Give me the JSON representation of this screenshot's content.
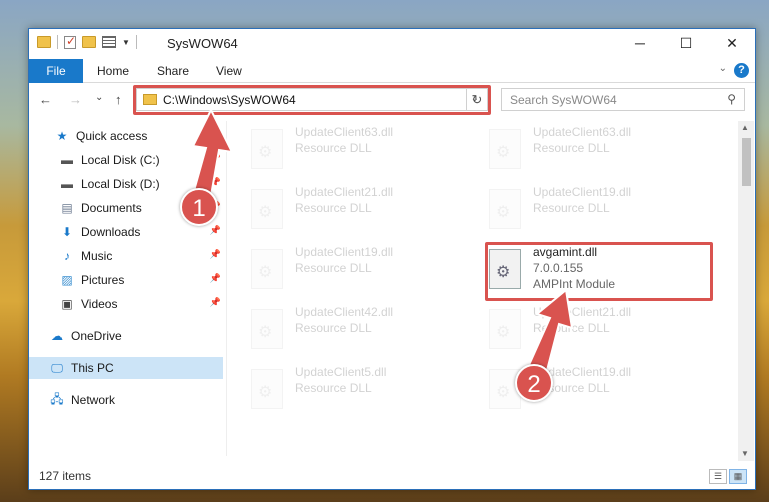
{
  "window": {
    "title": "SysWOW64",
    "controls": {
      "minimize": "─",
      "maximize": "☐",
      "close": "✕"
    }
  },
  "ribbon": {
    "file_label": "File",
    "tabs": [
      "Home",
      "Share",
      "View"
    ],
    "help_label": "?"
  },
  "navigation": {
    "back": "←",
    "forward": "→",
    "recent": "⌄",
    "up": "↑",
    "address": "C:\\Windows\\SysWOW64",
    "refresh": "↻",
    "search_placeholder": "Search SysWOW64"
  },
  "sidebar": {
    "items": [
      {
        "label": "Quick access",
        "icon": "star-icon"
      },
      {
        "label": "Local Disk (C:)",
        "icon": "drive-icon"
      },
      {
        "label": "Local Disk (D:)",
        "icon": "drive-icon"
      },
      {
        "label": "Documents",
        "icon": "documents-icon"
      },
      {
        "label": "Downloads",
        "icon": "download-icon"
      },
      {
        "label": "Music",
        "icon": "music-icon"
      },
      {
        "label": "Pictures",
        "icon": "pictures-icon"
      },
      {
        "label": "Videos",
        "icon": "videos-icon"
      },
      {
        "label": "OneDrive",
        "icon": "cloud-icon"
      },
      {
        "label": "This PC",
        "icon": "monitor-icon"
      },
      {
        "label": "Network",
        "icon": "network-icon"
      }
    ]
  },
  "files": [
    {
      "name": "UpdateClient63.dll",
      "desc": "Resource DLL"
    },
    {
      "name": "UpdateClient63.dll",
      "desc": "Resource DLL"
    },
    {
      "name": "UpdateClient21.dll",
      "desc": "Resource DLL"
    },
    {
      "name": "UpdateClient19.dll",
      "desc": "Resource DLL"
    },
    {
      "name": "UpdateClient19.dll",
      "desc": "Resource DLL"
    },
    {
      "name": "avgamint.dll",
      "version": "7.0.0.155",
      "desc": "AMPInt Module"
    },
    {
      "name": "UpdateClient42.dll",
      "desc": "Resource DLL"
    },
    {
      "name": "UpdateClient21.dll",
      "desc": "Resource DLL"
    },
    {
      "name": "UpdateClient5.dll",
      "desc": "Resource DLL"
    },
    {
      "name": "UpdateClient19.dll",
      "desc": "Resource DLL"
    }
  ],
  "status": {
    "item_count": "127 items"
  },
  "annotations": {
    "one": "1",
    "two": "2"
  },
  "colors": {
    "accent": "#1979ca",
    "highlight": "#d9534f",
    "selected": "#cce4f7"
  }
}
